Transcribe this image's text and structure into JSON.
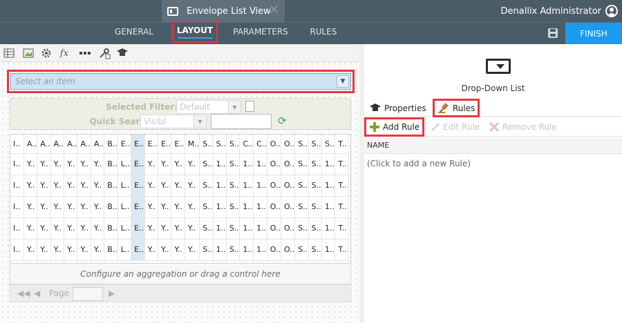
{
  "window": {
    "tab_title": "Envelope List View",
    "tab_icon": "form-view-icon",
    "close_glyph": "✕",
    "user_name": "Denallix Administrator"
  },
  "nav": {
    "tabs": [
      {
        "label": "GENERAL"
      },
      {
        "label": "LAYOUT"
      },
      {
        "label": "PARAMETERS"
      },
      {
        "label": "RULES"
      }
    ],
    "active_tab": "LAYOUT",
    "finish_label": "FINISH"
  },
  "colors": {
    "header_bg": "#4a5c68",
    "finish_bg": "#1a9af0",
    "highlight_outline": "#e8363c",
    "dropdown_bg": "#cfe3f6"
  },
  "toolbar": {
    "icons": [
      "table-icon",
      "image-icon",
      "gear-icon",
      "fx-icon",
      "ellipsis-icon",
      "tools-icon",
      "graduation-icon"
    ],
    "fx_label": "fx"
  },
  "dropdown": {
    "placeholder": "Select an item"
  },
  "filter": {
    "selected_filter_label": "Selected Filter:",
    "selected_filter_value": "Default",
    "quick_search_label": "Quick Search:",
    "quick_search_value": "Visibl"
  },
  "grid": {
    "headers": [
      "I..",
      "A..",
      "A..",
      "A..",
      "A..",
      "A..",
      "A..",
      "B..",
      "E..",
      "E..",
      "E..",
      "E..",
      "E..",
      "M..",
      "S..",
      "S..",
      "S..",
      "C..",
      "C..",
      "O..",
      "O..",
      "S..",
      "S..",
      "S..",
      "T.."
    ],
    "row": [
      "I..",
      "Y..",
      "Y..",
      "Y..",
      "Y..",
      "Y..",
      "Y..",
      "B..",
      "L..",
      "E..",
      "Y..",
      "Y..",
      "Y..",
      "Y..",
      "S..",
      "1..",
      "S..",
      "1..",
      "1..",
      "O..",
      "O..",
      "S..",
      "S..",
      "1..",
      "T.."
    ],
    "row_count": 5,
    "selected_column": 9,
    "aggregation_hint": "Configure an aggregation or drag a control here",
    "pager_label": "Page"
  },
  "properties": {
    "control_name": "Drop-Down List",
    "tabs": {
      "properties": "Properties",
      "rules": "Rules"
    },
    "actions": {
      "add": "Add Rule",
      "edit": "Edit Rule",
      "remove": "Remove Rule"
    },
    "column_header": "NAME",
    "empty_rule": "(Click to add a new Rule)"
  }
}
